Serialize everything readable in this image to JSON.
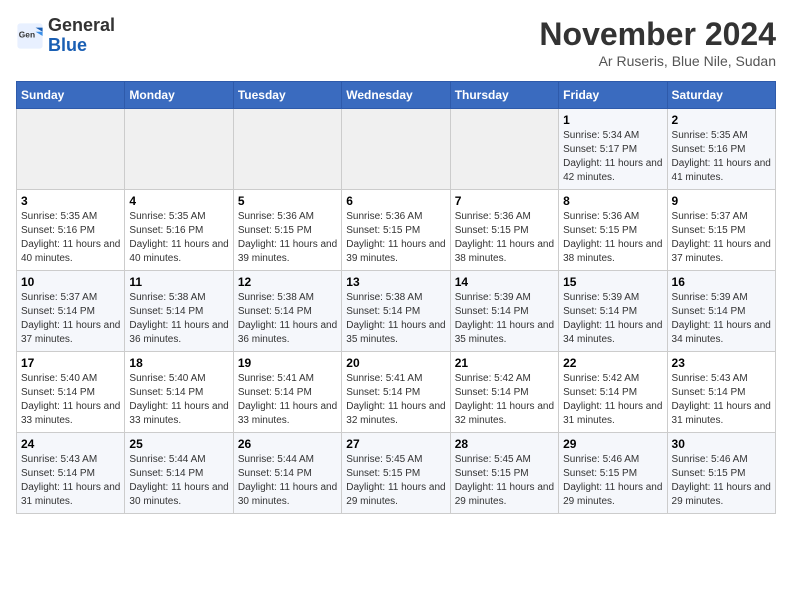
{
  "header": {
    "logo_general": "General",
    "logo_blue": "Blue",
    "month_year": "November 2024",
    "location": "Ar Ruseris, Blue Nile, Sudan"
  },
  "days_of_week": [
    "Sunday",
    "Monday",
    "Tuesday",
    "Wednesday",
    "Thursday",
    "Friday",
    "Saturday"
  ],
  "weeks": [
    [
      {
        "day": "",
        "info": ""
      },
      {
        "day": "",
        "info": ""
      },
      {
        "day": "",
        "info": ""
      },
      {
        "day": "",
        "info": ""
      },
      {
        "day": "",
        "info": ""
      },
      {
        "day": "1",
        "info": "Sunrise: 5:34 AM\nSunset: 5:17 PM\nDaylight: 11 hours and 42 minutes."
      },
      {
        "day": "2",
        "info": "Sunrise: 5:35 AM\nSunset: 5:16 PM\nDaylight: 11 hours and 41 minutes."
      }
    ],
    [
      {
        "day": "3",
        "info": "Sunrise: 5:35 AM\nSunset: 5:16 PM\nDaylight: 11 hours and 40 minutes."
      },
      {
        "day": "4",
        "info": "Sunrise: 5:35 AM\nSunset: 5:16 PM\nDaylight: 11 hours and 40 minutes."
      },
      {
        "day": "5",
        "info": "Sunrise: 5:36 AM\nSunset: 5:15 PM\nDaylight: 11 hours and 39 minutes."
      },
      {
        "day": "6",
        "info": "Sunrise: 5:36 AM\nSunset: 5:15 PM\nDaylight: 11 hours and 39 minutes."
      },
      {
        "day": "7",
        "info": "Sunrise: 5:36 AM\nSunset: 5:15 PM\nDaylight: 11 hours and 38 minutes."
      },
      {
        "day": "8",
        "info": "Sunrise: 5:36 AM\nSunset: 5:15 PM\nDaylight: 11 hours and 38 minutes."
      },
      {
        "day": "9",
        "info": "Sunrise: 5:37 AM\nSunset: 5:15 PM\nDaylight: 11 hours and 37 minutes."
      }
    ],
    [
      {
        "day": "10",
        "info": "Sunrise: 5:37 AM\nSunset: 5:14 PM\nDaylight: 11 hours and 37 minutes."
      },
      {
        "day": "11",
        "info": "Sunrise: 5:38 AM\nSunset: 5:14 PM\nDaylight: 11 hours and 36 minutes."
      },
      {
        "day": "12",
        "info": "Sunrise: 5:38 AM\nSunset: 5:14 PM\nDaylight: 11 hours and 36 minutes."
      },
      {
        "day": "13",
        "info": "Sunrise: 5:38 AM\nSunset: 5:14 PM\nDaylight: 11 hours and 35 minutes."
      },
      {
        "day": "14",
        "info": "Sunrise: 5:39 AM\nSunset: 5:14 PM\nDaylight: 11 hours and 35 minutes."
      },
      {
        "day": "15",
        "info": "Sunrise: 5:39 AM\nSunset: 5:14 PM\nDaylight: 11 hours and 34 minutes."
      },
      {
        "day": "16",
        "info": "Sunrise: 5:39 AM\nSunset: 5:14 PM\nDaylight: 11 hours and 34 minutes."
      }
    ],
    [
      {
        "day": "17",
        "info": "Sunrise: 5:40 AM\nSunset: 5:14 PM\nDaylight: 11 hours and 33 minutes."
      },
      {
        "day": "18",
        "info": "Sunrise: 5:40 AM\nSunset: 5:14 PM\nDaylight: 11 hours and 33 minutes."
      },
      {
        "day": "19",
        "info": "Sunrise: 5:41 AM\nSunset: 5:14 PM\nDaylight: 11 hours and 33 minutes."
      },
      {
        "day": "20",
        "info": "Sunrise: 5:41 AM\nSunset: 5:14 PM\nDaylight: 11 hours and 32 minutes."
      },
      {
        "day": "21",
        "info": "Sunrise: 5:42 AM\nSunset: 5:14 PM\nDaylight: 11 hours and 32 minutes."
      },
      {
        "day": "22",
        "info": "Sunrise: 5:42 AM\nSunset: 5:14 PM\nDaylight: 11 hours and 31 minutes."
      },
      {
        "day": "23",
        "info": "Sunrise: 5:43 AM\nSunset: 5:14 PM\nDaylight: 11 hours and 31 minutes."
      }
    ],
    [
      {
        "day": "24",
        "info": "Sunrise: 5:43 AM\nSunset: 5:14 PM\nDaylight: 11 hours and 31 minutes."
      },
      {
        "day": "25",
        "info": "Sunrise: 5:44 AM\nSunset: 5:14 PM\nDaylight: 11 hours and 30 minutes."
      },
      {
        "day": "26",
        "info": "Sunrise: 5:44 AM\nSunset: 5:14 PM\nDaylight: 11 hours and 30 minutes."
      },
      {
        "day": "27",
        "info": "Sunrise: 5:45 AM\nSunset: 5:15 PM\nDaylight: 11 hours and 29 minutes."
      },
      {
        "day": "28",
        "info": "Sunrise: 5:45 AM\nSunset: 5:15 PM\nDaylight: 11 hours and 29 minutes."
      },
      {
        "day": "29",
        "info": "Sunrise: 5:46 AM\nSunset: 5:15 PM\nDaylight: 11 hours and 29 minutes."
      },
      {
        "day": "30",
        "info": "Sunrise: 5:46 AM\nSunset: 5:15 PM\nDaylight: 11 hours and 29 minutes."
      }
    ]
  ]
}
